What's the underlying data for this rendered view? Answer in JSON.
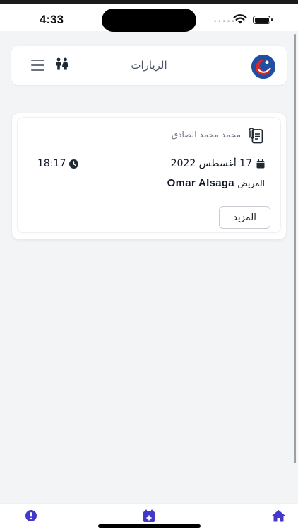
{
  "status_bar": {
    "time": "4:33",
    "signal_dots": "•••••"
  },
  "header": {
    "title": "الزيارات"
  },
  "visits": [
    {
      "doctor_name": "محمد محمد الصادق",
      "date": "17 أغسطس 2022",
      "time": "18:17",
      "patient_label": "المريض",
      "patient_name": "Omar Alsaga",
      "more_label": "المزيد"
    }
  ],
  "colors": {
    "accent": "#4338ca",
    "background": "#f3f4f6",
    "card": "#ffffff",
    "logo_blue": "#1d4fa3",
    "logo_red": "#d62828"
  },
  "icons": {
    "menu": "hamburger-icon",
    "family": "people-icon",
    "document": "document-clip-icon",
    "calendar": "calendar-icon",
    "clock": "clock-icon",
    "alert": "exclamation-circle-icon",
    "appointment": "calendar-plus-icon",
    "home": "home-icon"
  }
}
